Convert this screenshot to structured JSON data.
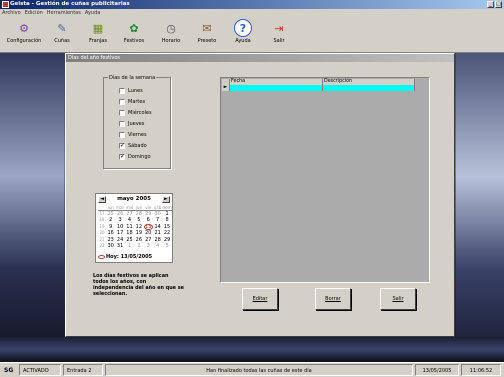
{
  "app": {
    "title": "Gelsta - Gestión de cuñas publicitarias",
    "window_buttons": [
      "_",
      "□"
    ]
  },
  "menu": [
    "Archivo",
    "Edición",
    "Herramientas",
    "Ayuda"
  ],
  "toolbar": [
    {
      "label": "Configuración",
      "icon": "configuration-icon",
      "glyph": "⚙",
      "color": "#7b3fa0"
    },
    {
      "label": "Cuñas",
      "icon": "wedges-icon",
      "glyph": "✎",
      "color": "#3c6aa8"
    },
    {
      "label": "Franjas",
      "icon": "slots-icon",
      "glyph": "▦",
      "color": "#6b8e23"
    },
    {
      "label": "Festivos",
      "icon": "holidays-icon",
      "glyph": "✿",
      "color": "#1e8a3a"
    },
    {
      "label": "Horario",
      "icon": "clock-icon",
      "glyph": "◷",
      "color": "#555"
    },
    {
      "label": "Preseto",
      "icon": "preset-icon",
      "glyph": "✉",
      "color": "#8a5a2b"
    },
    {
      "label": "Ayuda",
      "icon": "help-icon",
      "glyph": "?",
      "color": "#2a5bd7"
    },
    {
      "label": "Salir",
      "icon": "exit-icon",
      "glyph": "⇥",
      "color": "#c0392b"
    }
  ],
  "dialog": {
    "title": "Días del año festivos",
    "weekdays_group_label": "Días de la semana",
    "weekdays": [
      {
        "label": "Lunes",
        "checked": false
      },
      {
        "label": "Martes",
        "checked": false
      },
      {
        "label": "Miércoles",
        "checked": false
      },
      {
        "label": "Jueves",
        "checked": false
      },
      {
        "label": "Viernes",
        "checked": false
      },
      {
        "label": "Sábado",
        "checked": true
      },
      {
        "label": "Domingo",
        "checked": true
      }
    ],
    "calendar": {
      "month_label": "mayo 2005",
      "prev": "◄",
      "next": "►",
      "dow": [
        "lun",
        "mar",
        "mié",
        "jue",
        "vie",
        "sáb",
        "dom"
      ],
      "weeks": [
        {
          "wk": "17",
          "days": [
            "25",
            "26",
            "27",
            "28",
            "29",
            "30",
            "1"
          ],
          "gray": [
            true,
            true,
            true,
            true,
            true,
            true,
            false
          ]
        },
        {
          "wk": "18",
          "days": [
            "2",
            "3",
            "4",
            "5",
            "6",
            "7",
            "8"
          ],
          "gray": [
            false,
            false,
            false,
            false,
            false,
            false,
            false
          ]
        },
        {
          "wk": "19",
          "days": [
            "9",
            "10",
            "11",
            "12",
            "13",
            "14",
            "15"
          ],
          "gray": [
            false,
            false,
            false,
            false,
            false,
            false,
            false
          ]
        },
        {
          "wk": "20",
          "days": [
            "16",
            "17",
            "18",
            "19",
            "20",
            "21",
            "22"
          ],
          "gray": [
            false,
            false,
            false,
            false,
            false,
            false,
            false
          ]
        },
        {
          "wk": "21",
          "days": [
            "23",
            "24",
            "25",
            "26",
            "27",
            "28",
            "29"
          ],
          "gray": [
            false,
            false,
            false,
            false,
            false,
            false,
            false
          ]
        },
        {
          "wk": "22",
          "days": [
            "30",
            "31",
            "1",
            "2",
            "3",
            "4",
            "5"
          ],
          "gray": [
            false,
            false,
            true,
            true,
            true,
            true,
            true
          ]
        }
      ],
      "today_label": "Hoy: 13/05/2005",
      "selected_day": "13"
    },
    "note": "Los días festivos se aplican todos los años, con independencia del año en que se seleccionan.",
    "table": {
      "columns": [
        "Fecha",
        "Descripción"
      ],
      "row_indicator": "►"
    },
    "buttons": {
      "edit": "Editar",
      "delete": "Borrar",
      "exit": "Salir"
    }
  },
  "status": {
    "logo": "SG",
    "state": "ACTIVADO",
    "entry": "Entrada 2",
    "message": "Han finalizado todas las cuñas de este día",
    "date": "13/05/2005",
    "time": "11:06:52"
  }
}
